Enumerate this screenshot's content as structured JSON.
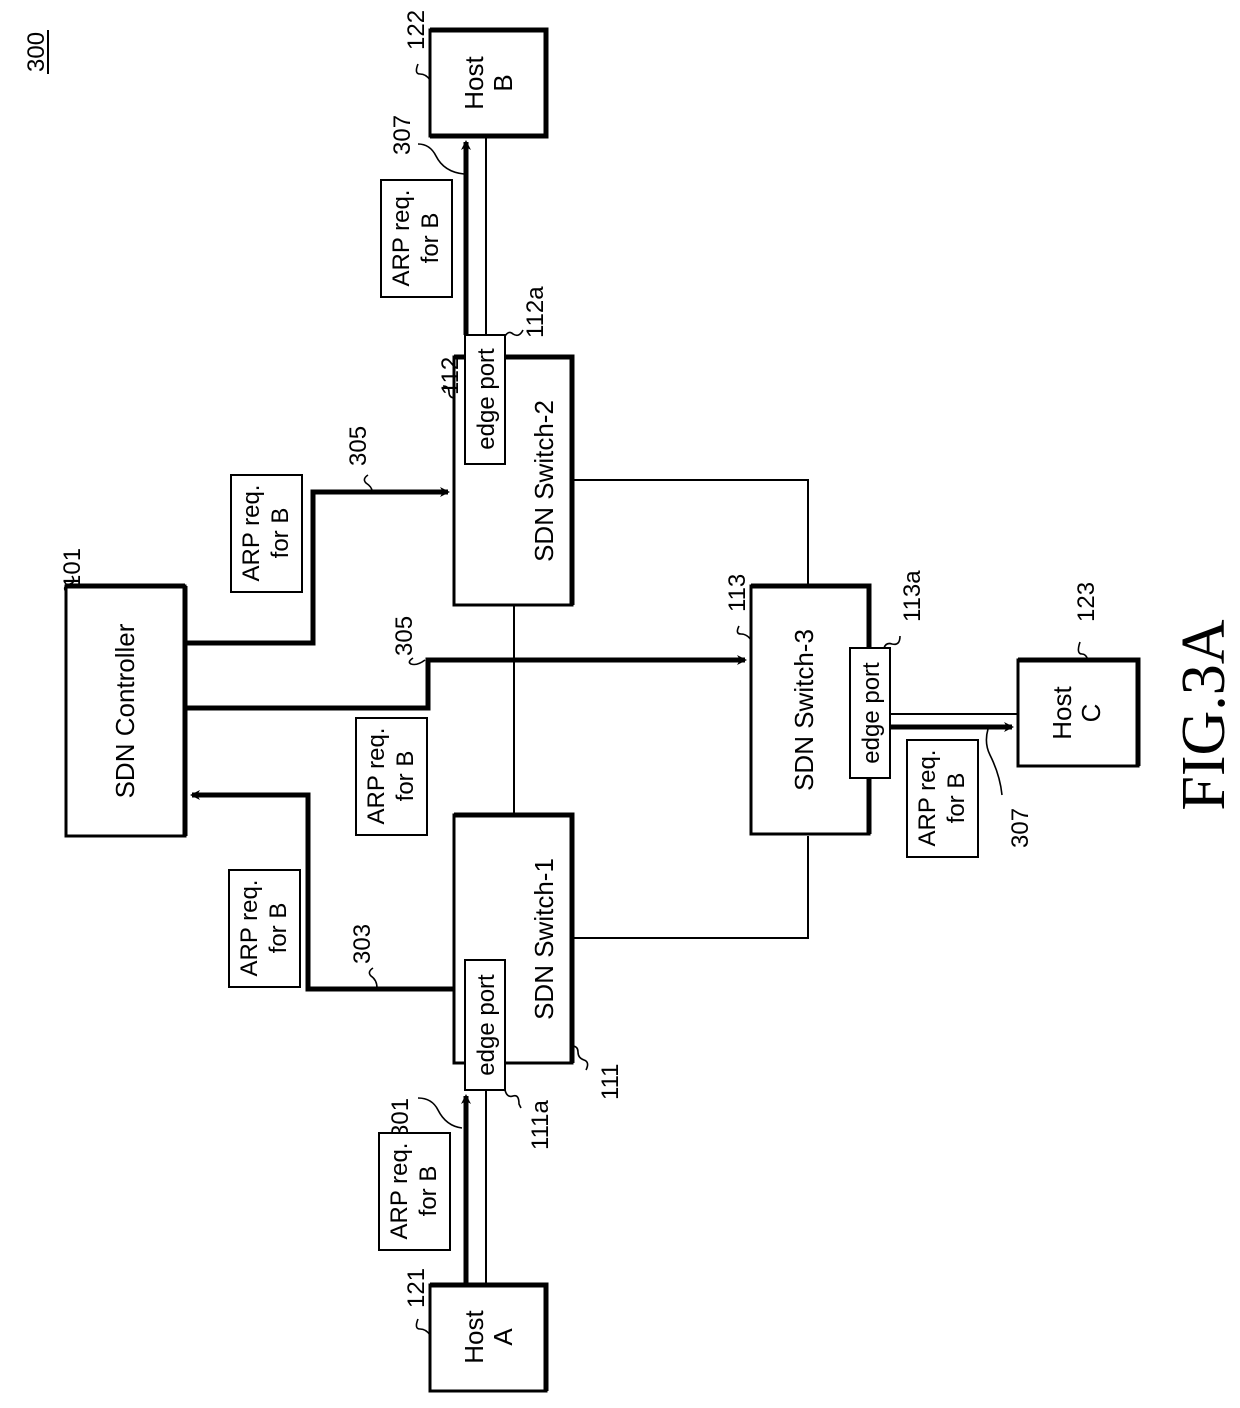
{
  "figure": {
    "number_ref": "300",
    "caption": "FIG.3A"
  },
  "nodes": {
    "controller": {
      "label": "SDN Controller",
      "ref": "101"
    },
    "switch1": {
      "label": "SDN Switch-1",
      "ref": "111",
      "port_label": "edge port",
      "port_ref": "111a"
    },
    "switch2": {
      "label": "SDN Switch-2",
      "ref": "112",
      "port_label": "edge port",
      "port_ref": "112a"
    },
    "switch3": {
      "label": "SDN Switch-3",
      "ref": "113",
      "port_label": "edge port",
      "port_ref": "113a"
    },
    "hostA": {
      "line1": "Host",
      "line2": "A",
      "ref": "121"
    },
    "hostB": {
      "line1": "Host",
      "line2": "B",
      "ref": "122"
    },
    "hostC": {
      "line1": "Host",
      "line2": "C",
      "ref": "123"
    }
  },
  "messages": {
    "line1": "ARP req.",
    "line2": "for B"
  },
  "flows": {
    "f301": "301",
    "f303": "303",
    "f305a": "305",
    "f305b": "305",
    "f307a": "307",
    "f307b": "307"
  }
}
